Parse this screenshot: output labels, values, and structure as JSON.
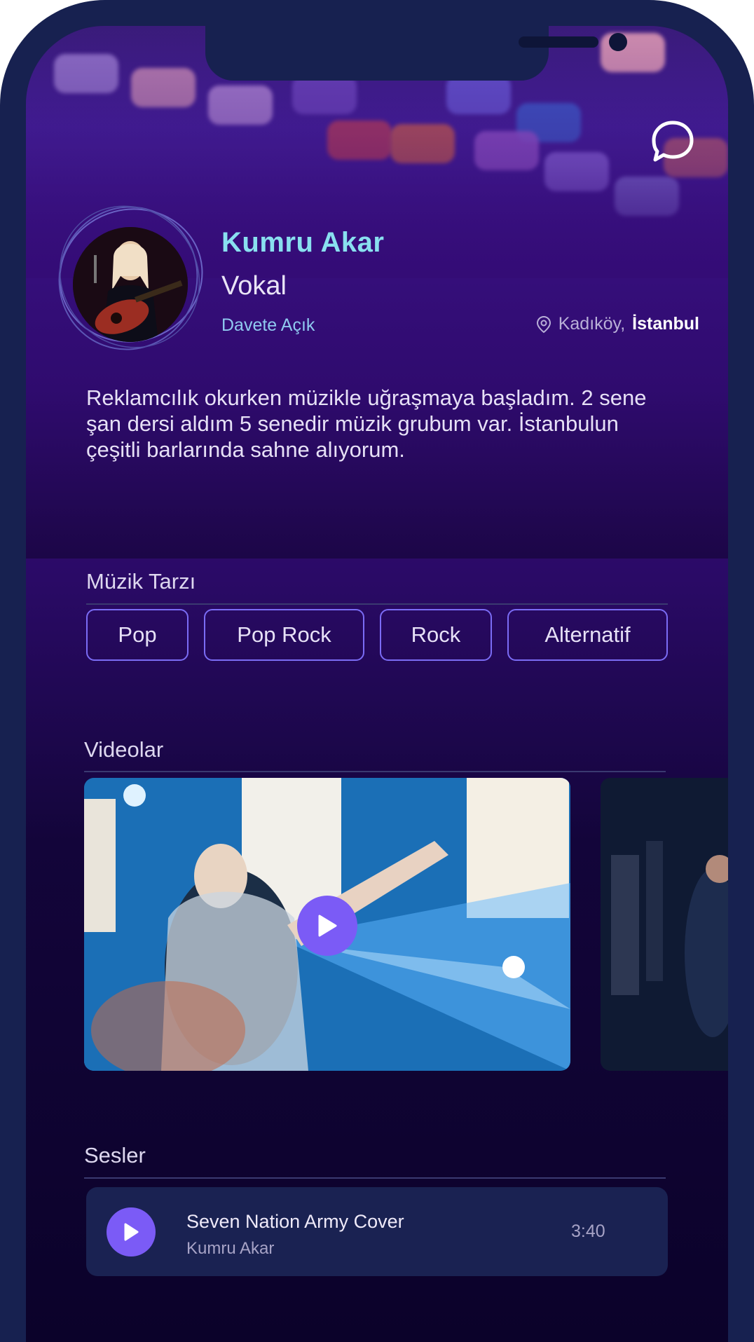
{
  "profile": {
    "name": "Kumru Akar",
    "role": "Vokal",
    "availability": "Davete Açık",
    "district": "Kadıköy,",
    "city": "İstanbul",
    "bio": "Reklamcılık okurken müzikle uğraşmaya başladım. 2 sene şan dersi aldım 5 senedir müzik grubum var. İstanbulun çeşitli barlarında sahne alıyorum."
  },
  "music_style": {
    "title": "Müzik Tarzı",
    "tags": [
      "Pop",
      "Pop Rock",
      "Rock",
      "Alternatif"
    ]
  },
  "videos": {
    "title": "Videolar"
  },
  "sounds": {
    "title": "Sesler",
    "tracks": [
      {
        "title": "Seven Nation Army Cover",
        "artist": "Kumru Akar",
        "duration": "3:40"
      }
    ]
  },
  "colors": {
    "frame": "#172150",
    "accent": "#7b5bf6",
    "name": "#89e0ef",
    "tag_border": "#7b6cf5"
  },
  "icons": {
    "chat": "chat-bubble-icon",
    "location": "location-pin-icon",
    "play": "play-icon"
  }
}
